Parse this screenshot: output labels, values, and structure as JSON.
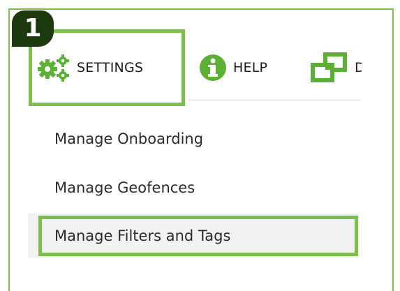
{
  "step": {
    "number": "1"
  },
  "menu": {
    "items": [
      {
        "label": "SETTINGS",
        "icon": "gears-icon"
      },
      {
        "label": "HELP",
        "icon": "info-icon"
      },
      {
        "label": "D",
        "icon": "windows-icon"
      }
    ]
  },
  "dropdown": {
    "items": [
      {
        "label": "Manage Onboarding"
      },
      {
        "label": "Manage Geofences"
      },
      {
        "label": "Manage Filters and Tags",
        "selected": true
      }
    ]
  },
  "colors": {
    "highlight": "#7dbf4a",
    "badge_bg": "#1d3a0f",
    "icon_green": "#5cb034",
    "selected_bg": "#f2f2f2"
  }
}
